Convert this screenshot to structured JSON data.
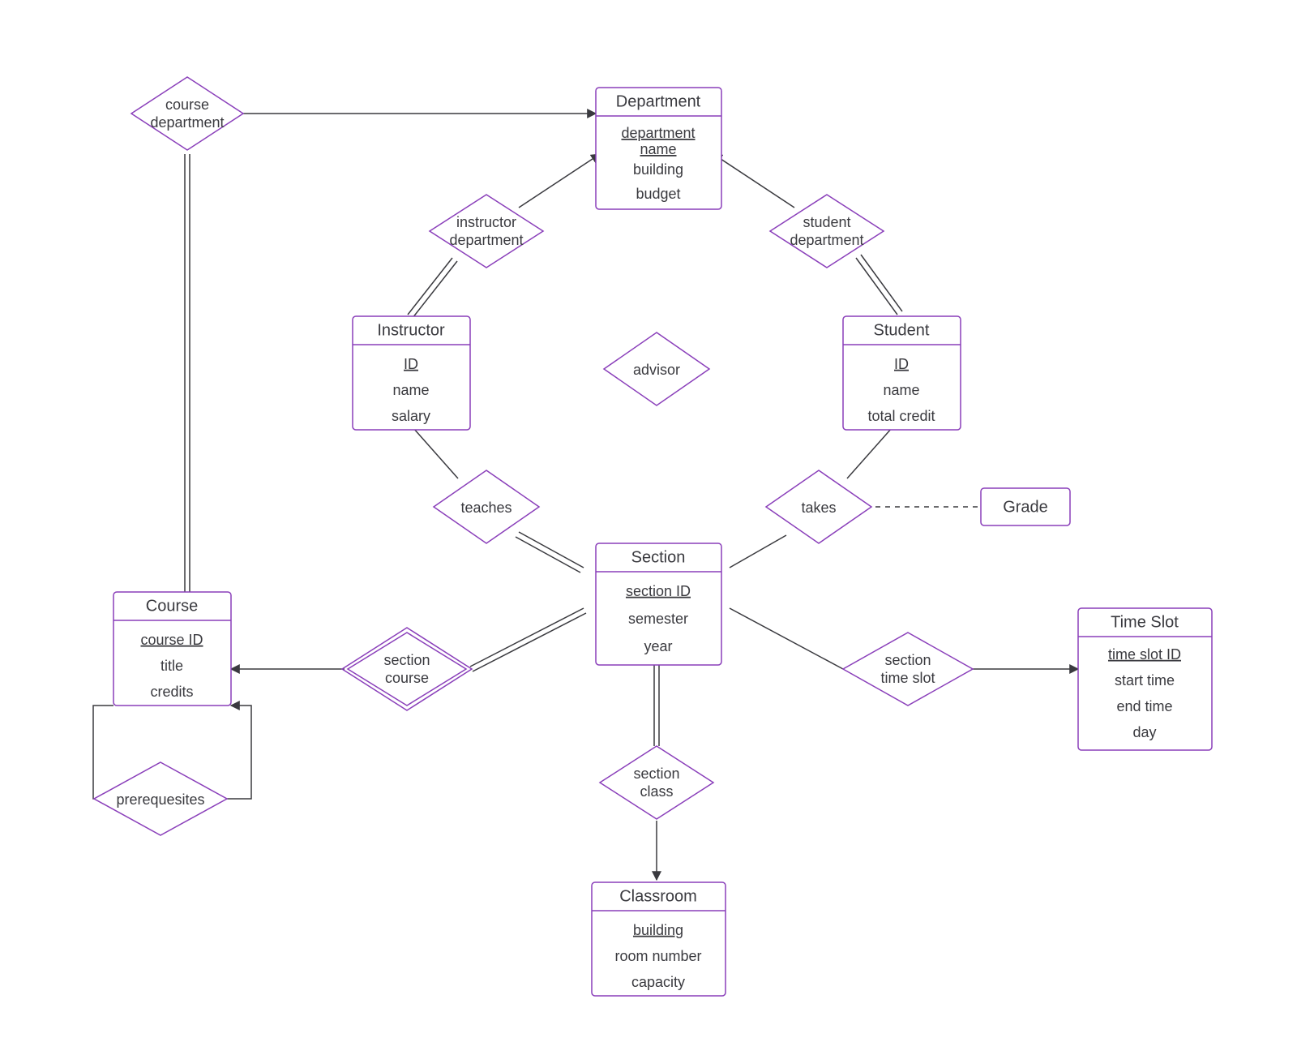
{
  "entities": {
    "department": {
      "title": "Department",
      "attrs": [
        "department name",
        "building",
        "budget"
      ],
      "pk": [
        0
      ]
    },
    "instructor": {
      "title": "Instructor",
      "attrs": [
        "ID",
        "name",
        "salary"
      ],
      "pk": [
        0
      ]
    },
    "student": {
      "title": "Student",
      "attrs": [
        "ID",
        "name",
        "total credit"
      ],
      "pk": [
        0
      ]
    },
    "section": {
      "title": "Section",
      "attrs": [
        "section ID",
        "semester",
        "year"
      ],
      "pk": [
        0
      ]
    },
    "course": {
      "title": "Course",
      "attrs": [
        "course ID",
        "title",
        "credits"
      ],
      "pk": [
        0
      ]
    },
    "classroom": {
      "title": "Classroom",
      "attrs": [
        "building",
        "room number",
        "capacity"
      ],
      "pk": [
        0
      ]
    },
    "timeslot": {
      "title": "Time Slot",
      "attrs": [
        "time slot ID",
        "start time",
        "end time",
        "day"
      ],
      "pk": [
        0
      ]
    },
    "grade": {
      "title": "Grade"
    }
  },
  "relationships": {
    "course_department": {
      "label_lines": [
        "course",
        "department"
      ]
    },
    "instructor_department": {
      "label_lines": [
        "instructor",
        "department"
      ]
    },
    "student_department": {
      "label_lines": [
        "student",
        "department"
      ]
    },
    "advisor": {
      "label_lines": [
        "advisor"
      ]
    },
    "teaches": {
      "label_lines": [
        "teaches"
      ]
    },
    "takes": {
      "label_lines": [
        "takes"
      ]
    },
    "section_course": {
      "label_lines": [
        "section",
        "course"
      ]
    },
    "section_class": {
      "label_lines": [
        "section",
        "class"
      ]
    },
    "section_time_slot": {
      "label_lines": [
        "section",
        "time slot"
      ]
    },
    "prerequisites": {
      "label_lines": [
        "prerequesites"
      ]
    }
  }
}
